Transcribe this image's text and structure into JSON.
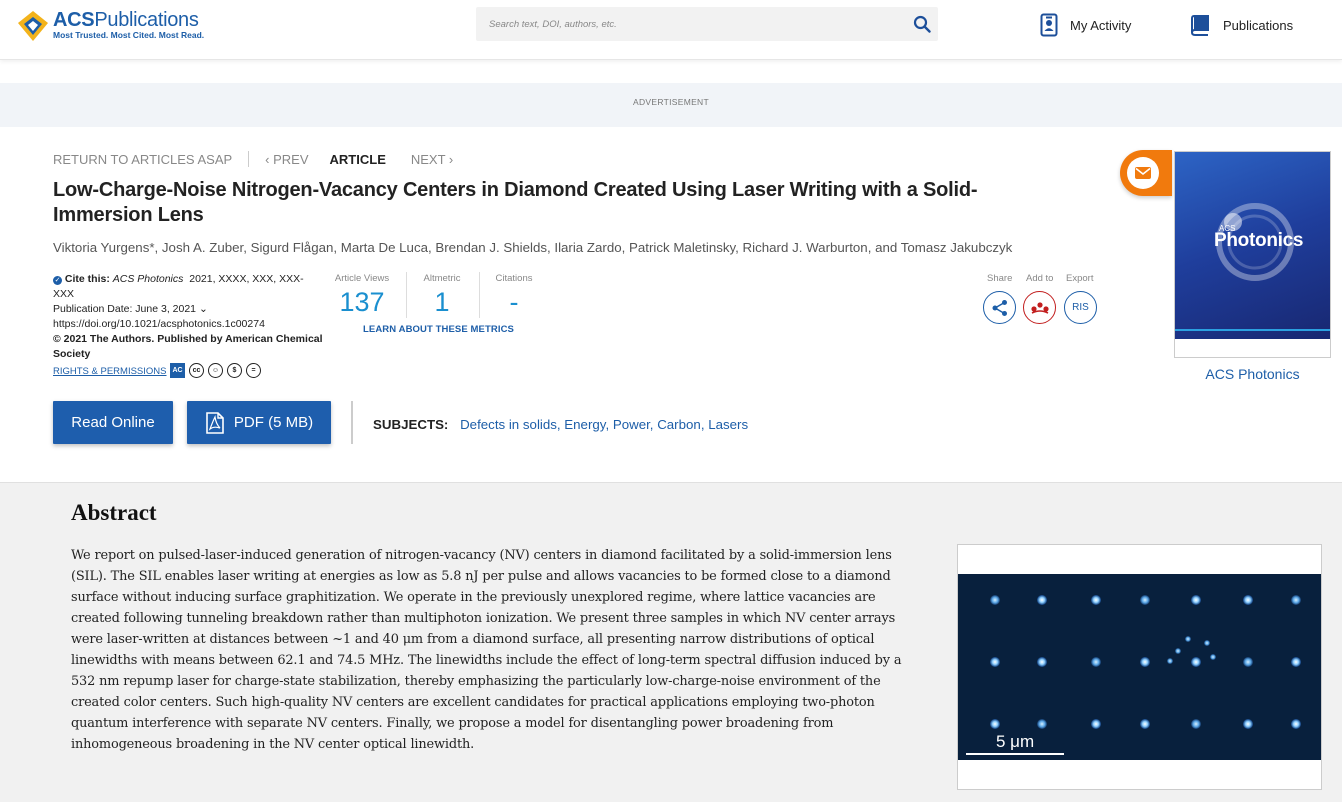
{
  "header": {
    "logo_name_bold": "ACS",
    "logo_name": "Publications",
    "logo_tagline": "Most Trusted. Most Cited. Most Read.",
    "search_placeholder": "Search text, DOI, authors, etc.",
    "nav": [
      {
        "label": "My Activity",
        "icon": "user-badge-icon"
      },
      {
        "label": "Publications",
        "icon": "book-icon"
      }
    ]
  },
  "ad_label": "ADVERTISEMENT",
  "article_nav": {
    "return": "RETURN TO ARTICLES ASAP",
    "prev": "PREV",
    "current": "ARTICLE",
    "next": "NEXT"
  },
  "article": {
    "title": "Low-Charge-Noise Nitrogen-Vacancy Centers in Diamond Created Using Laser Writing with a Solid-Immersion Lens",
    "authors": "Viktoria Yurgens*, Josh A. Zuber, Sigurd Flågan, Marta De Luca, Brendan J. Shields, Ilaria Zardo, Patrick Maletinsky, Richard J. Warburton, and Tomasz Jakubczyk",
    "cite_label": "Cite this:",
    "cite_journal": "ACS Photonics",
    "cite_rest": "2021, XXXX, XXX, XXX-XXX",
    "pub_date": "Publication Date: June 3, 2021",
    "doi": "https://doi.org/10.1021/acsphotonics.1c00274",
    "copyright": "© 2021 The Authors. Published by American Chemical Society",
    "rights": "RIGHTS & PERMISSIONS",
    "license_icons": [
      "AC",
      "cc",
      "by",
      "nc",
      "nd"
    ]
  },
  "metrics": {
    "views_label": "Article Views",
    "views": "137",
    "altmetric_label": "Altmetric",
    "altmetric": "1",
    "citations_label": "Citations",
    "citations": "-",
    "learn": "LEARN ABOUT THESE METRICS"
  },
  "actions": {
    "share": "Share",
    "add_to": "Add to",
    "export": "Export",
    "export_btn": "RIS"
  },
  "buttons": {
    "read_online": "Read Online",
    "pdf": "PDF (5 MB)"
  },
  "subjects": {
    "label": "SUBJECTS:",
    "items": [
      "Defects in solids",
      "Energy",
      "Power",
      "Carbon",
      "Lasers"
    ]
  },
  "journal": {
    "cover_acs": "ACS",
    "cover_title": "Photonics",
    "caption": "ACS Photonics"
  },
  "abstract": {
    "heading": "Abstract",
    "text": "We report on pulsed-laser-induced generation of nitrogen-vacancy (NV) centers in diamond facilitated by a solid-immersion lens (SIL). The SIL enables laser writing at energies as low as 5.8 nJ per pulse and allows vacancies to be formed close to a diamond surface without inducing surface graphitization. We operate in the previously unexplored regime, where lattice vacancies are created following tunneling breakdown rather than multiphoton ionization. We present three samples in which NV center arrays were laser-written at distances between ~1 and 40 μm from a diamond surface, all presenting narrow distributions of optical linewidths with means between 62.1 and 74.5 MHz. The linewidths include the effect of long-term spectral diffusion induced by a 532 nm repump laser for charge-state stabilization, thereby emphasizing the particularly low-charge-noise environment of the created color centers. Such high-quality NV centers are excellent candidates for practical applications employing two-photon quantum interference with separate NV centers. Finally, we propose a model for disentangling power broadening from inhomogeneous broadening in the NV center optical linewidth.",
    "toc_scale": "5 μm"
  }
}
